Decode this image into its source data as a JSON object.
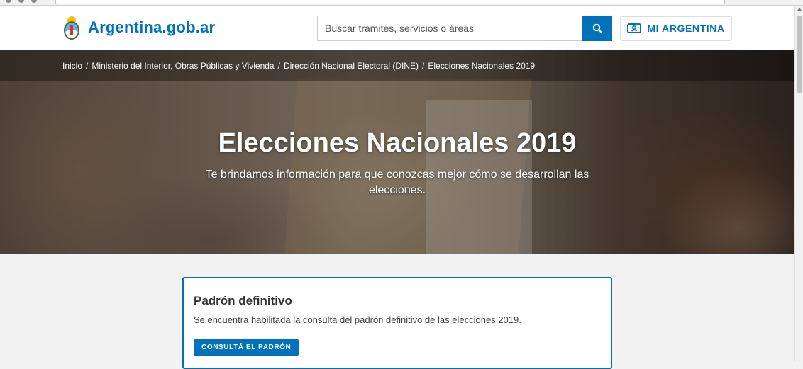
{
  "header": {
    "logo_text": "Argentina.gob.ar",
    "search_placeholder": "Buscar trámites, servicios o áreas",
    "search_icon": "search-icon",
    "account_button_label": "MI ARGENTINA",
    "account_icon": "id-card-icon",
    "brand_color": "#0072bb"
  },
  "breadcrumb": {
    "items": [
      "Inicio",
      "Ministerio del Interior, Obras Públicas y Vivienda",
      "Dirección Nacional Electoral (DINE)",
      "Elecciones Nacionales 2019"
    ],
    "separator": "/"
  },
  "hero": {
    "title": "Elecciones Nacionales 2019",
    "subtitle": "Te brindamos información para que conozcas mejor cómo se desarrollan las elecciones."
  },
  "card": {
    "title": "Padrón definitivo",
    "text": "Se encuentra habilitada la consulta del padrón definitivo de las elecciones 2019.",
    "button_label": "CONSULTÁ EL PADRÓN"
  }
}
